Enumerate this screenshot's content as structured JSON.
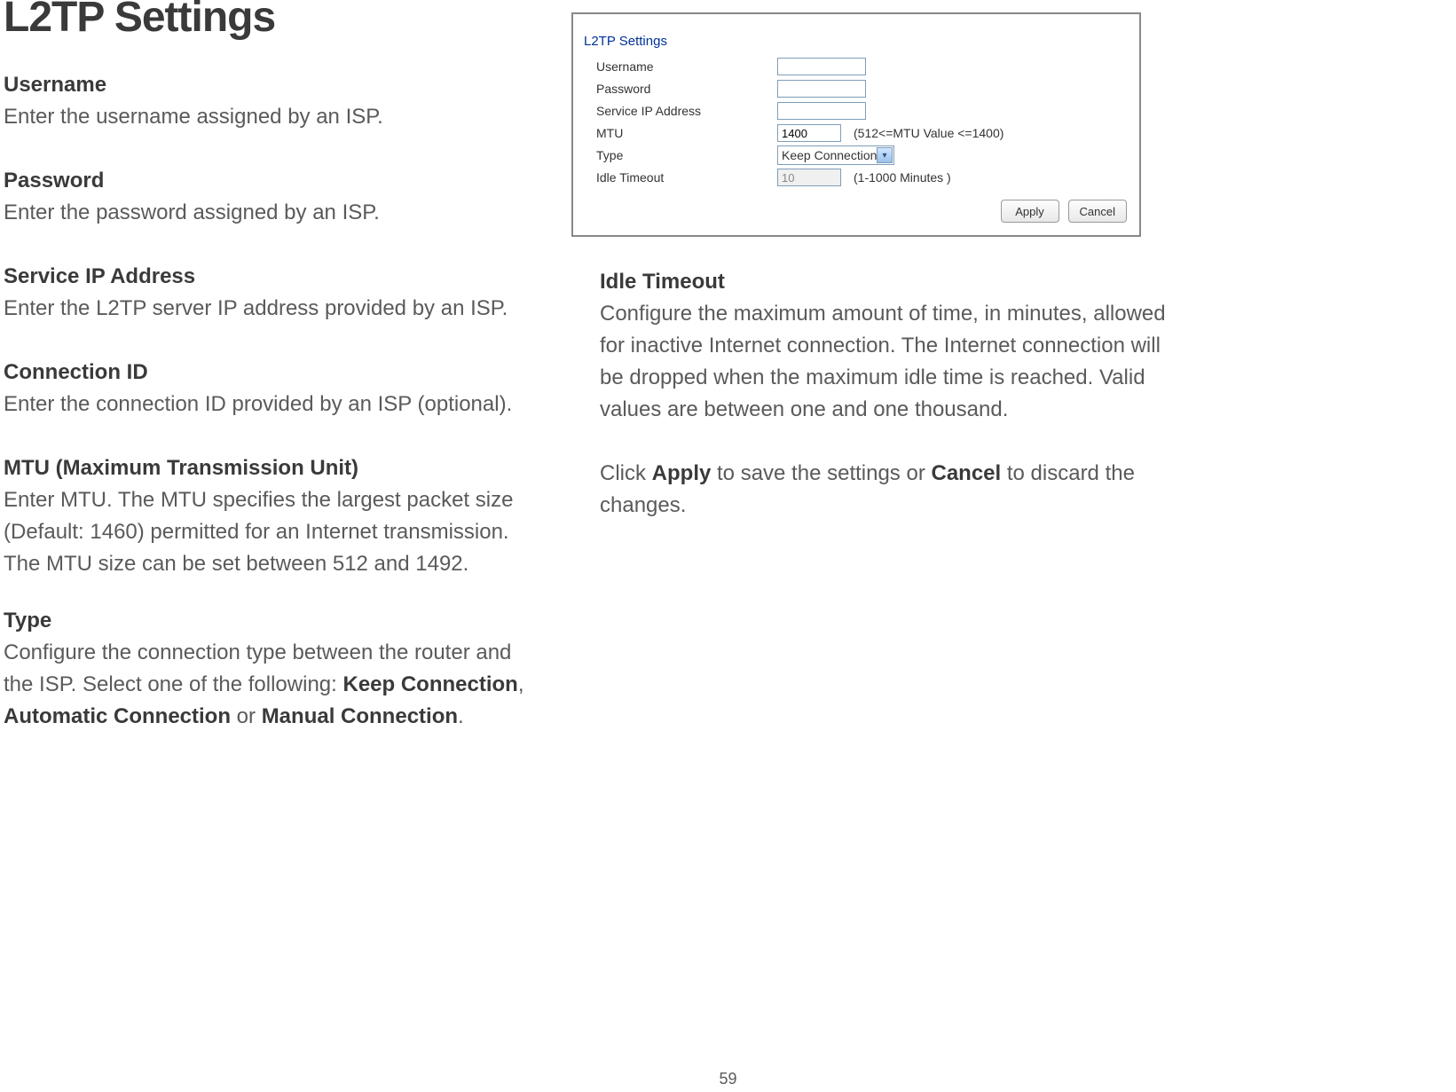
{
  "title": "L2TP Settings",
  "page_number": "59",
  "left": {
    "username": {
      "label": "Username",
      "desc": "Enter the username assigned by an ISP."
    },
    "password": {
      "label": "Password",
      "desc": "Enter the password assigned by an ISP."
    },
    "service_ip": {
      "label": "Service IP Address",
      "desc": "Enter the L2TP server IP address provided by an ISP."
    },
    "connection_id": {
      "label": "Connection ID",
      "desc": "Enter the connection ID provided by an ISP (optional)."
    },
    "mtu": {
      "label": "MTU (Maximum Transmission Unit)",
      "desc": "Enter MTU. The MTU specifies the largest packet size (Default: 1460) permitted for an Internet transmission. The MTU size can be set between 512 and 1492."
    },
    "type": {
      "label": "Type",
      "desc_pre": "Configure the connection type between the router and the ISP. Select one of the following: ",
      "opt1": "Keep Connection",
      "sep1": ", ",
      "opt2": "Automatic Connection",
      "sep2": " or ",
      "opt3": "Manual Connection",
      "desc_post": "."
    }
  },
  "right": {
    "idle_timeout": {
      "label": "Idle Timeout",
      "desc": "Configure the maximum amount of time, in minutes, allowed for inactive Internet connection. The Internet connection will be dropped when the maximum idle time is reached. Valid values are between one and one thousand."
    },
    "apply_line": {
      "pre": "Click ",
      "apply": "Apply",
      "mid": " to save the settings or ",
      "cancel": "Cancel",
      "post": " to discard the changes."
    }
  },
  "screenshot": {
    "title": "L2TP Settings",
    "rows": {
      "username": {
        "label": "Username",
        "value": ""
      },
      "password": {
        "label": "Password",
        "value": ""
      },
      "service_ip": {
        "label": "Service IP Address",
        "value": ""
      },
      "mtu": {
        "label": "MTU",
        "value": "1400",
        "hint": "(512<=MTU Value <=1400)"
      },
      "type": {
        "label": "Type",
        "value": "Keep Connection"
      },
      "idle_timeout": {
        "label": "Idle Timeout",
        "value": "10",
        "hint": "(1-1000 Minutes )"
      }
    },
    "buttons": {
      "apply": "Apply",
      "cancel": "Cancel"
    }
  }
}
